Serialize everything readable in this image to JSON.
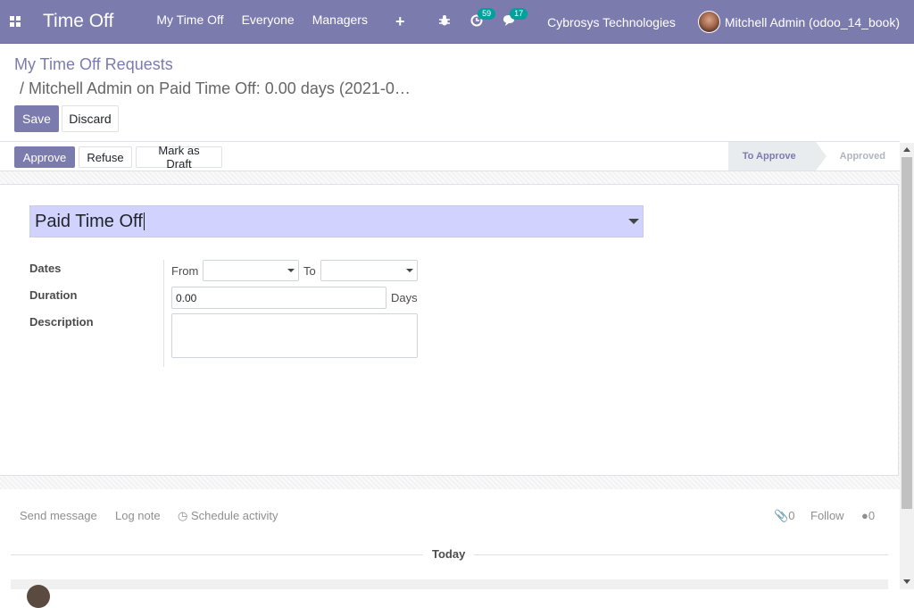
{
  "navbar": {
    "brand": "Time Off",
    "menu": [
      "My Time Off",
      "Everyone",
      "Managers"
    ],
    "activity_count": "59",
    "message_count": "17",
    "company": "Cybrosys Technologies",
    "user": "Mitchell Admin (odoo_14_book)"
  },
  "breadcrumb": {
    "parent": "My Time Off Requests",
    "current": "/ Mitchell Admin on Paid Time Off: 0.00 days (2021-0…"
  },
  "buttons": {
    "save": "Save",
    "discard": "Discard"
  },
  "statusbar": {
    "approve": "Approve",
    "refuse": "Refuse",
    "draft": "Mark as Draft",
    "stages": [
      "To Approve",
      "Approved"
    ]
  },
  "form": {
    "leave_type": "Paid Time Off",
    "labels": {
      "dates": "Dates",
      "duration": "Duration",
      "description": "Description"
    },
    "from": "From",
    "to": "To",
    "duration_value": "0.00",
    "days": "Days"
  },
  "chatter": {
    "send_message": "Send message",
    "log_note": "Log note",
    "schedule_activity": "Schedule activity",
    "attachments": "0",
    "follow": "Follow",
    "followers": "0",
    "today": "Today"
  }
}
